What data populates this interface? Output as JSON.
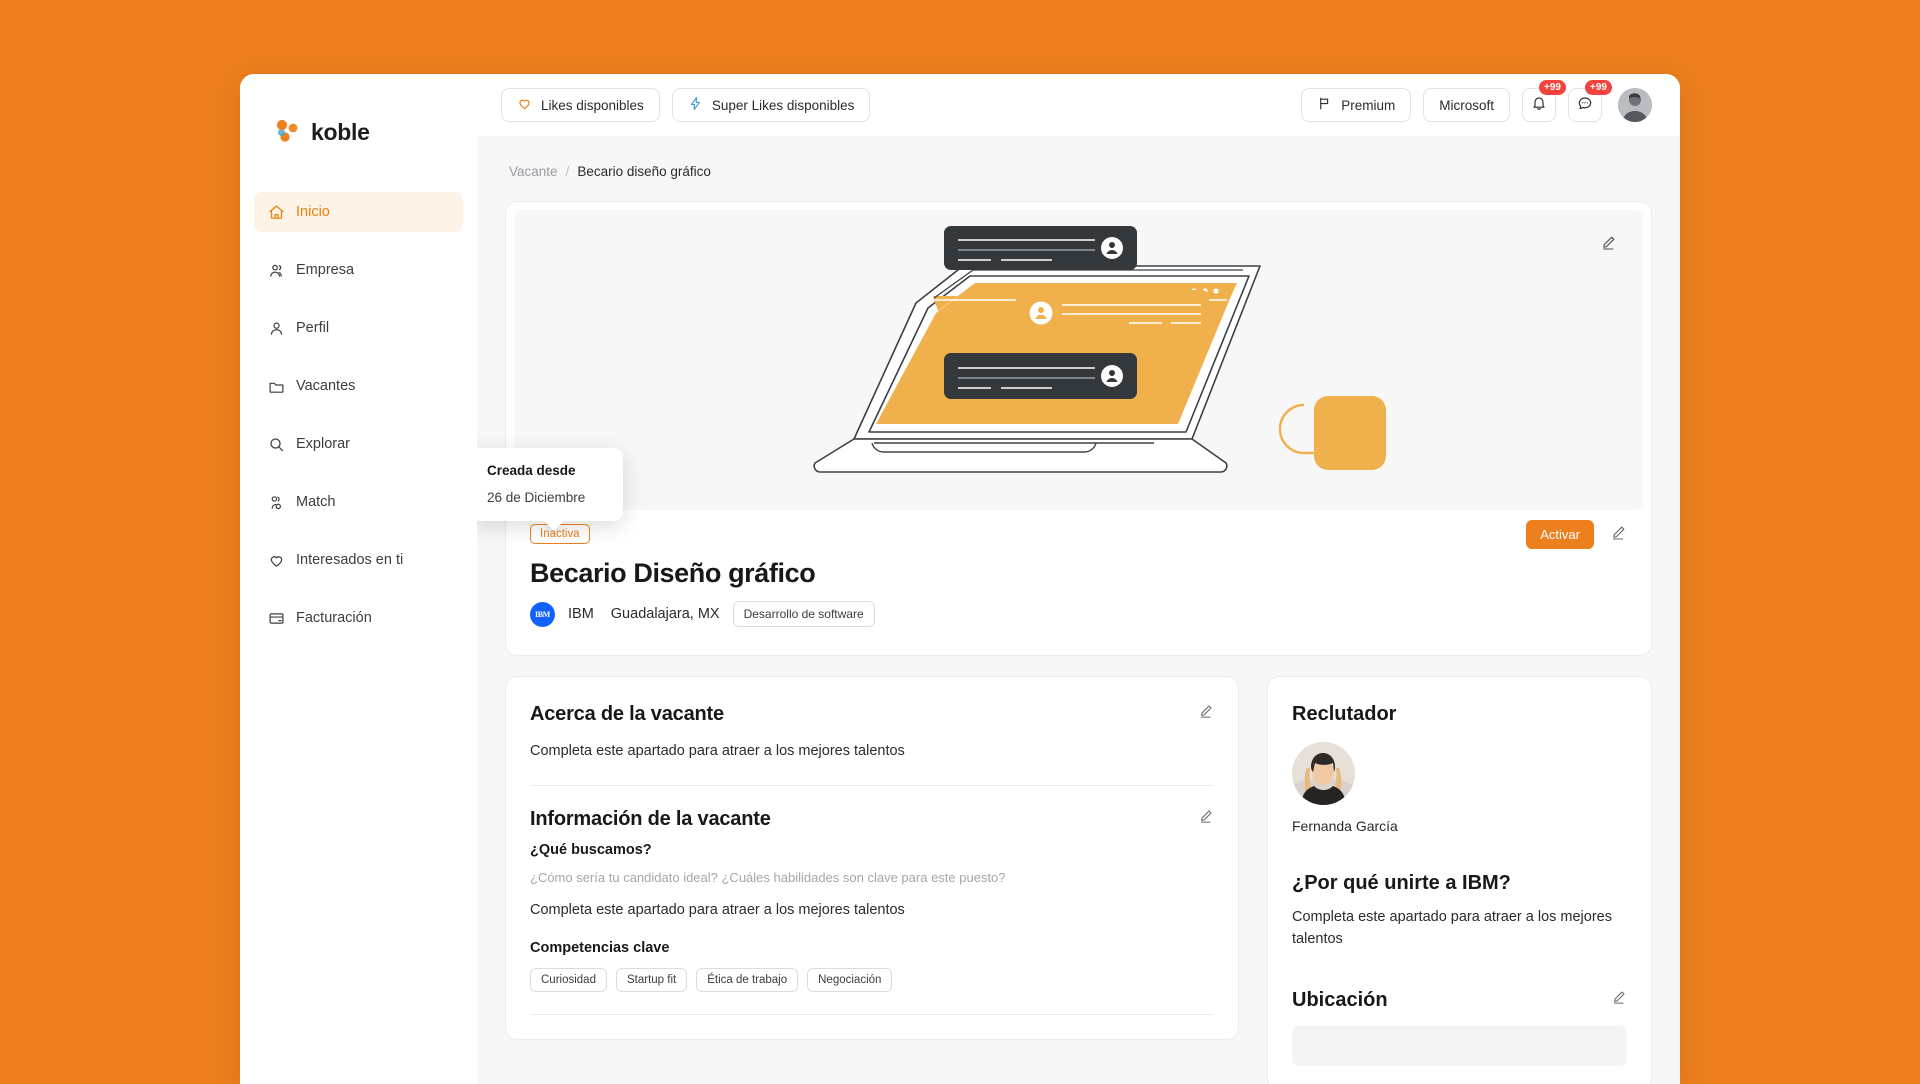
{
  "brand": {
    "name": "koble"
  },
  "sidebar": {
    "items": [
      {
        "label": "Inicio",
        "icon": "home-icon",
        "active": true
      },
      {
        "label": "Empresa",
        "icon": "company-icon",
        "active": false
      },
      {
        "label": "Perfil",
        "icon": "user-icon",
        "active": false
      },
      {
        "label": "Vacantes",
        "icon": "folder-icon",
        "active": false
      },
      {
        "label": "Explorar",
        "icon": "search-icon",
        "active": false
      },
      {
        "label": "Match",
        "icon": "match-icon",
        "active": false
      },
      {
        "label": "Interesados en ti",
        "icon": "heart-icon",
        "active": false
      },
      {
        "label": "Facturación",
        "icon": "card-icon",
        "active": false
      }
    ]
  },
  "topbar": {
    "likes_label": "Likes disponibles",
    "super_likes_label": "Super Likes disponibles",
    "premium_label": "Premium",
    "company_label": "Microsoft",
    "notifications_badge": "+99",
    "messages_badge": "+99"
  },
  "breadcrumb": {
    "parent": "Vacante",
    "separator": "/",
    "current": "Becario diseño gráfico"
  },
  "hero": {
    "status_chip": "Inactiva",
    "activate_label": "Activar",
    "tooltip": {
      "title": "Creada desde",
      "value": "26 de Diciembre"
    },
    "job_title": "Becario Diseño gráfico",
    "company": "IBM",
    "company_mark": "IBM",
    "location": "Guadalajara, MX",
    "category_tag": "Desarrollo de software"
  },
  "about": {
    "title": "Acerca de la vacante",
    "body": "Completa este apartado para atraer a los mejores talentos"
  },
  "info": {
    "title": "Información de la vacante",
    "question_label": "¿Qué buscamos?",
    "question_placeholder": "¿Cómo sería tu candidato ideal? ¿Cuáles habilidades son clave para este puesto?",
    "body": "Completa este apartado para atraer a los mejores talentos",
    "skills_label": "Competencias clave",
    "skills": [
      "Curiosidad",
      "Startup fit",
      "Ética de trabajo",
      "Negociación"
    ]
  },
  "recruiter": {
    "title": "Reclutador",
    "name": "Fernanda García"
  },
  "why": {
    "title": "¿Por qué unirte a IBM?",
    "body": "Completa este apartado para atraer a los mejores talentos"
  },
  "location_section": {
    "title": "Ubicación"
  },
  "colors": {
    "brand_orange": "#ED7F1C",
    "accent_soft": "#FDF3E7",
    "badge_red": "#F4433C",
    "ibm_blue": "#1261FE",
    "illustration_yellow": "#F0B04C",
    "illustration_dark": "#33383C"
  }
}
